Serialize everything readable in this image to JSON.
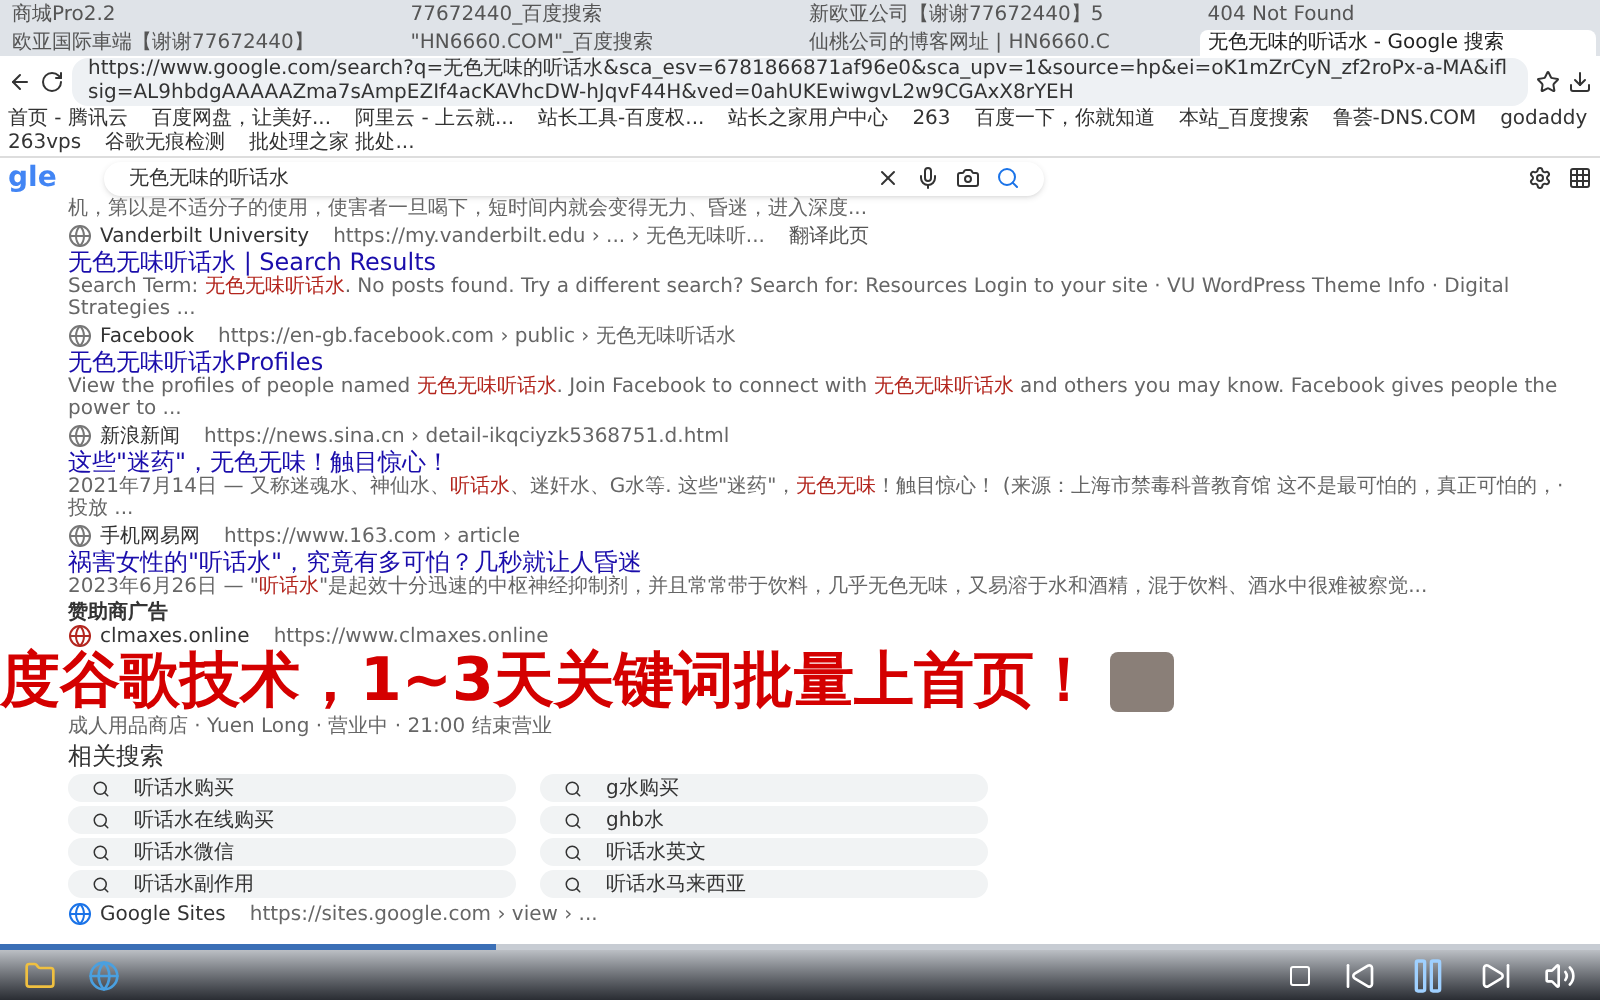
{
  "tabs": [
    {
      "label": "商城Pro2.2",
      "selected": false
    },
    {
      "label": "77672440_百度搜索",
      "selected": false
    },
    {
      "label": "新欧亚公司【谢谢77672440】5",
      "selected": false
    },
    {
      "label": "404 Not Found",
      "selected": false
    },
    {
      "label": "欧亚国际車端【谢谢77672440】",
      "selected": false
    },
    {
      "label": "\"HN6660.COM\"_百度搜索",
      "selected": false
    },
    {
      "label": "仙桃公司的博客网址 | HN6660.C",
      "selected": false
    },
    {
      "label": "无色无味的听话水 - Google 搜索",
      "selected": true
    }
  ],
  "address_bar": {
    "url": "https://www.google.com/search?q=无色无味的听话水&sca_esv=6781866871af96e0&sca_upv=1&source=hp&ei=oK1mZrCyN_zf2roPx-a-MA&iflsig=AL9hbdgAAAAAZma7sAmpEZIf4acKAVhcDW-hJqvF44H&ved=0ahUKEwiwgvL2w9CGAxX8rYEH"
  },
  "bookmarks": [
    "首页 - 腾讯云",
    "百度网盘，让美好...",
    "阿里云 - 上云就...",
    "站长工具-百度权...",
    "站长之家用户中心",
    "263",
    "百度一下，你就知道",
    "本站_百度搜索",
    "鲁荟-DNS.COM",
    "godaddy",
    "263vps",
    "谷歌无痕检测",
    "批处理之家 批处..."
  ],
  "search": {
    "logo": "gle",
    "value": "无色无味的听话水"
  },
  "top_snippet": "机，第以是不适分子的使用，使害者一旦喝下，短时间内就会变得无力、昏迷，进入深度...",
  "results": [
    {
      "site": "Vanderbilt University",
      "url": "https://my.vanderbilt.edu › ... › 无色无味听...",
      "translate": "翻译此页",
      "title": "无色无味听话水 | Search Results",
      "snippet": "Search Term: *无色无味听话水*. No posts found. Try a different search? Search for: Resources Login to your site · VU WordPress Theme Info · Digital Strategies ..."
    },
    {
      "site": "Facebook",
      "url": "https://en-gb.facebook.com › public › 无色无味听话水",
      "title": "无色无味听话水Profiles",
      "snippet": "View the profiles of people named *无色无味听话水*. Join Facebook to connect with *无色无味听话水* and others you may know. Facebook gives people the power to ..."
    },
    {
      "site": "新浪新闻",
      "url": "https://news.sina.cn › detail-ikqciyzk5368751.d.html",
      "title": "这些\"迷药\"，无色无味！触目惊心！",
      "snippet": "2021年7月14日 — 又称迷魂水、神仙水、*听话水*、迷奸水、G水等. 这些\"迷药\"，*无色无味*！触目惊心！ (来源：上海市禁毒科普教育馆 这不是最可怕的，真正可怕的，· 投放 ..."
    },
    {
      "site": "手机网易网",
      "url": "https://www.163.com › article",
      "title": "祸害女性的\"听话水\"，究竟有多可怕？几秒就让人昏迷",
      "snippet": "2023年6月26日 — \"*听话水*\"是起效十分迅速的中枢神经抑制剂，并且常常带于饮料，几乎无色无味，又易溶于水和酒精，混于饮料、酒水中很难被察觉..."
    }
  ],
  "ad": {
    "label": "赞助商广告",
    "site": "clmaxes.online",
    "url": "https://www.clmaxes.online",
    "footer": "成人用品商店 · Yuen Long · 营业中 · 21:00 结束营业"
  },
  "overlay_caption": "度谷歌技术，1~3天关键词批量上首页！",
  "related": {
    "title": "相关搜索",
    "items": [
      "听话水购买",
      "g水购买",
      "听话水在线购买",
      "ghb水",
      "听话水微信",
      "听话水英文",
      "听话水副作用",
      "听话水马来西亚"
    ]
  },
  "last_result": {
    "site": "Google Sites",
    "url": "https://sites.google.com › view › ..."
  },
  "player": {
    "progress": {
      "level": 0.31
    }
  }
}
